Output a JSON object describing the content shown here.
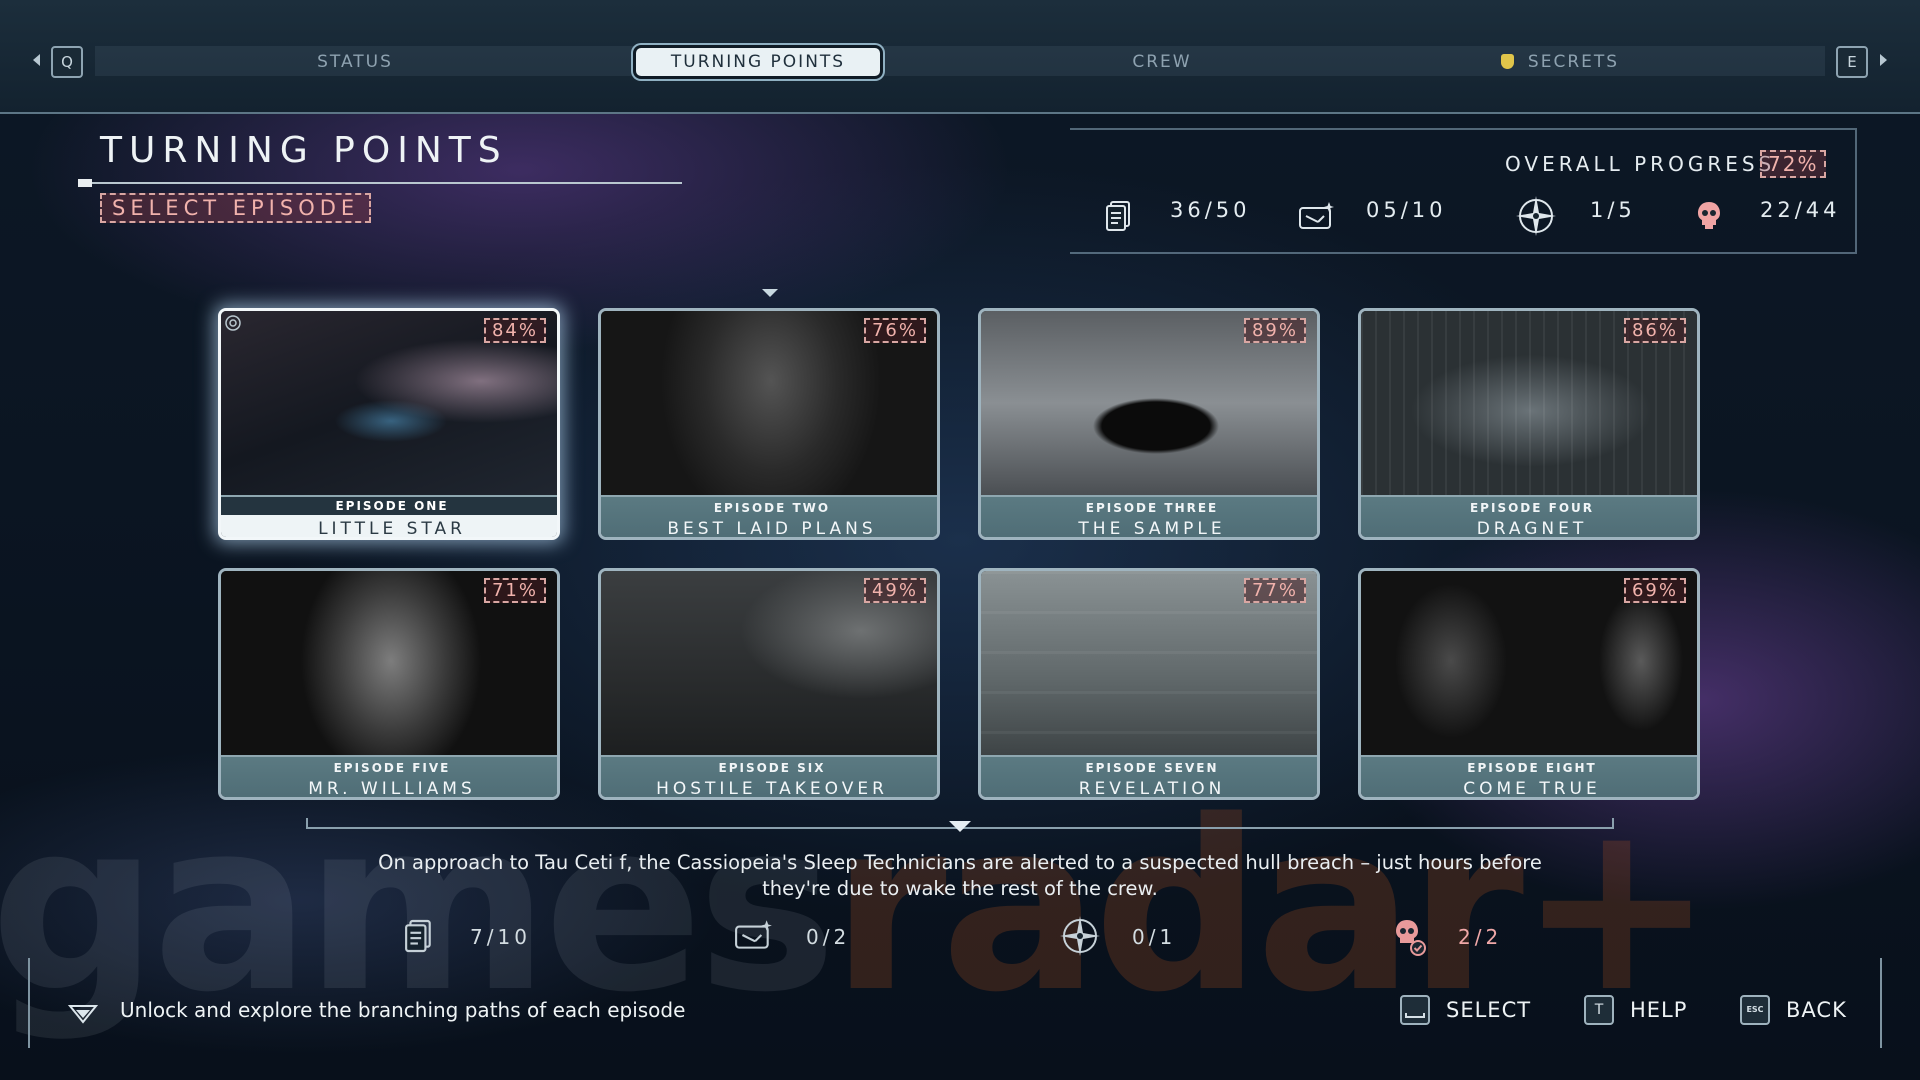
{
  "nav": {
    "prev_key": "Q",
    "next_key": "E",
    "tabs": [
      {
        "label": "STATUS"
      },
      {
        "label": "TURNING POINTS"
      },
      {
        "label": "CREW"
      },
      {
        "label": "SECRETS"
      }
    ],
    "active_tab": "TURNING POINTS"
  },
  "header": {
    "title": "TURNING POINTS",
    "subtitle": "SELECT EPISODE"
  },
  "overall": {
    "label": "OVERALL PROGRESS",
    "value": "72%",
    "stats": [
      {
        "icon": "document-icon",
        "value": "36/50"
      },
      {
        "icon": "tablet-icon",
        "value": "05/10"
      },
      {
        "icon": "compass-icon",
        "value": "1/5"
      },
      {
        "icon": "skull-icon",
        "value": "22/44"
      }
    ]
  },
  "episodes": [
    {
      "number": "EPISODE ONE",
      "title": "LITTLE STAR",
      "progress": "84%",
      "selected": true
    },
    {
      "number": "EPISODE TWO",
      "title": "BEST LAID PLANS",
      "progress": "76%",
      "selected": false
    },
    {
      "number": "EPISODE THREE",
      "title": "THE SAMPLE",
      "progress": "89%",
      "selected": false
    },
    {
      "number": "EPISODE FOUR",
      "title": "DRAGNET",
      "progress": "86%",
      "selected": false
    },
    {
      "number": "EPISODE FIVE",
      "title": "MR. WILLIAMS",
      "progress": "71%",
      "selected": false
    },
    {
      "number": "EPISODE SIX",
      "title": "HOSTILE TAKEOVER",
      "progress": "49%",
      "selected": false
    },
    {
      "number": "EPISODE SEVEN",
      "title": "REVELATION",
      "progress": "77%",
      "selected": false
    },
    {
      "number": "EPISODE EIGHT",
      "title": "COME TRUE",
      "progress": "69%",
      "selected": false
    }
  ],
  "selected_episode": {
    "description": "On approach to Tau Ceti f, the Cassiopeia's Sleep Technicians are alerted to a suspected hull breach – just hours before they're due to wake the rest of the crew.",
    "stats": [
      {
        "icon": "document-icon",
        "value": "7/10"
      },
      {
        "icon": "tablet-icon",
        "value": "0/2"
      },
      {
        "icon": "compass-icon",
        "value": "0/1"
      },
      {
        "icon": "skull-check-icon",
        "value": "2/2"
      }
    ]
  },
  "footer": {
    "hint": "Unlock and explore the branching paths of each episode",
    "buttons": [
      {
        "key": "",
        "label": "SELECT"
      },
      {
        "key": "T",
        "label": "HELP"
      },
      {
        "key": "ESC",
        "label": "BACK"
      }
    ]
  },
  "watermark": {
    "text_main": "games",
    "text_accent": "radar+"
  },
  "colors": {
    "accent_pink": "#f1b2ac",
    "secrets_gold": "#e0c54a",
    "card_bar": "#567580",
    "selected_highlight": "#eef4f6"
  }
}
